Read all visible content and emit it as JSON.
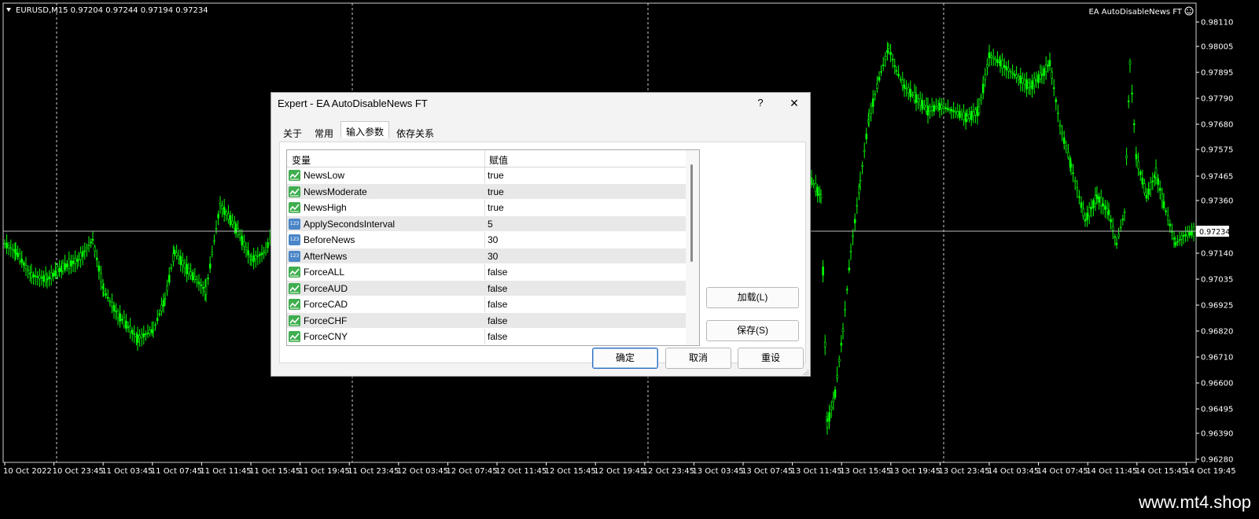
{
  "chart": {
    "info_label": "EURUSD,M15  0.97204 0.97244 0.97194 0.97234",
    "ea_label": "EA AutoDisableNews FT",
    "price_labels": [
      "0.98110",
      "0.98005",
      "0.97895",
      "0.97790",
      "0.97680",
      "0.97575",
      "0.97465",
      "0.97360",
      "0.97140",
      "0.97035",
      "0.96925",
      "0.96820",
      "0.96710",
      "0.96600",
      "0.96495",
      "0.96390",
      "0.96280"
    ],
    "current_price": "0.97234",
    "time_labels": [
      "10 Oct 2022",
      "10 Oct 23:45",
      "11 Oct 03:45",
      "11 Oct 07:45",
      "11 Oct 11:45",
      "11 Oct 15:45",
      "11 Oct 19:45",
      "11 Oct 23:45",
      "12 Oct 03:45",
      "12 Oct 07:45",
      "12 Oct 11:45",
      "12 Oct 15:45",
      "12 Oct 19:45",
      "12 Oct 23:45",
      "13 Oct 03:45",
      "13 Oct 07:45",
      "13 Oct 11:45",
      "13 Oct 15:45",
      "13 Oct 19:45",
      "13 Oct 23:45",
      "14 Oct 03:45",
      "14 Oct 07:45",
      "14 Oct 11:45",
      "14 Oct 15:45",
      "14 Oct 19:45"
    ],
    "colors": {
      "background": "#000000",
      "candles": "#00ff00",
      "grid": "#c8c8c8",
      "text": "#ffffff"
    }
  },
  "watermark": "www.mt4.shop",
  "dialog": {
    "title": "Expert - EA AutoDisableNews FT",
    "help_label": "?",
    "close_label": "✕",
    "tabs": [
      {
        "label": "关于"
      },
      {
        "label": "常用"
      },
      {
        "label": "输入参数"
      },
      {
        "label": "依存关系"
      }
    ],
    "active_tab": 2,
    "grid": {
      "col_variable": "变量",
      "col_value": "赋值",
      "rows": [
        {
          "name": "NewsLow",
          "value": "true",
          "icon": "bool-icon"
        },
        {
          "name": "NewsModerate",
          "value": "true",
          "icon": "bool-icon"
        },
        {
          "name": "NewsHigh",
          "value": "true",
          "icon": "bool-icon"
        },
        {
          "name": "ApplySecondsInterval",
          "value": "5",
          "icon": "number-icon"
        },
        {
          "name": "BeforeNews",
          "value": "30",
          "icon": "number-icon"
        },
        {
          "name": "AfterNews",
          "value": "30",
          "icon": "number-icon"
        },
        {
          "name": "ForceALL",
          "value": "false",
          "icon": "bool-icon"
        },
        {
          "name": "ForceAUD",
          "value": "false",
          "icon": "bool-icon"
        },
        {
          "name": "ForceCAD",
          "value": "false",
          "icon": "bool-icon"
        },
        {
          "name": "ForceCHF",
          "value": "false",
          "icon": "bool-icon"
        },
        {
          "name": "ForceCNY",
          "value": "false",
          "icon": "bool-icon"
        }
      ]
    },
    "buttons": {
      "load": "加载(L)",
      "save": "保存(S)",
      "ok": "确定",
      "cancel": "取消",
      "reset": "重设"
    }
  }
}
